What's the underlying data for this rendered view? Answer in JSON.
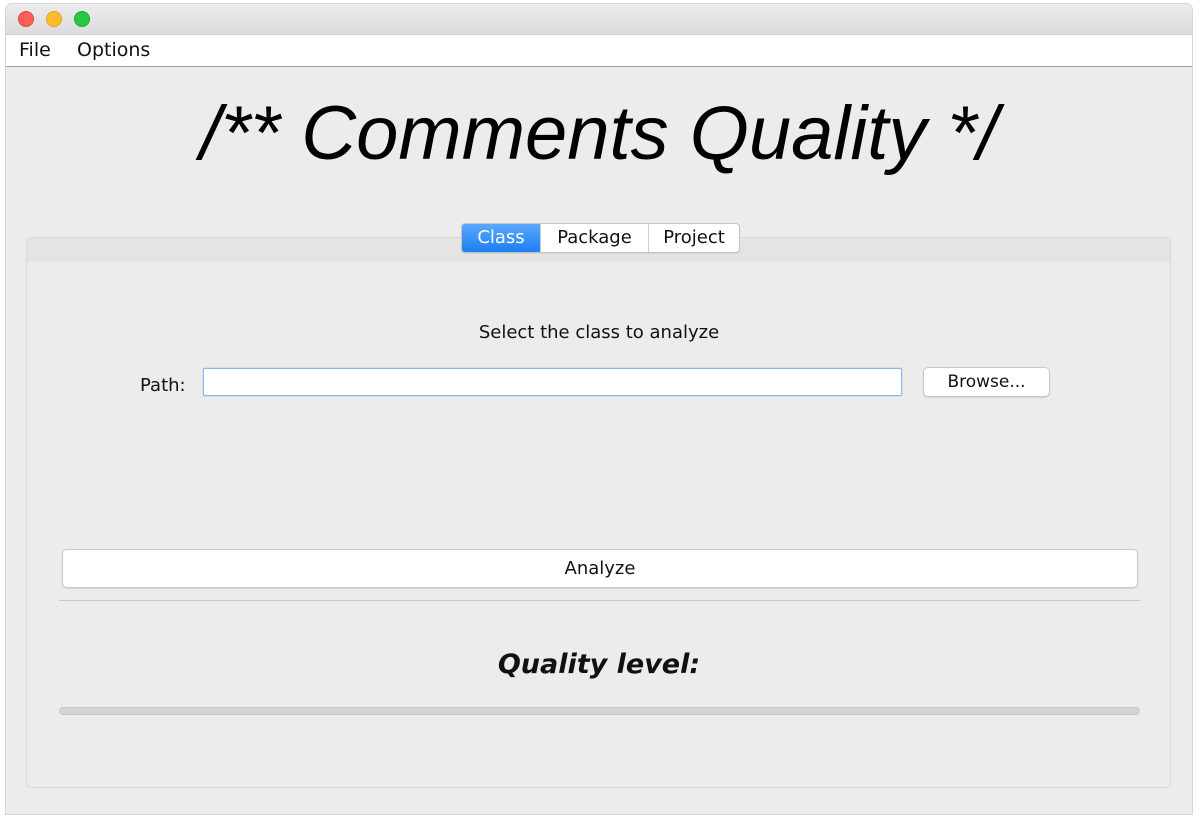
{
  "menu": {
    "file_label": "File",
    "options_label": "Options"
  },
  "app": {
    "title": "/** Comments Quality */"
  },
  "tabs": [
    {
      "label": "Class",
      "selected": true
    },
    {
      "label": "Package",
      "selected": false
    },
    {
      "label": "Project",
      "selected": false
    }
  ],
  "class_panel": {
    "instruction": "Select the class to analyze",
    "path_label": "Path:",
    "path_value": "",
    "browse_label": "Browse...",
    "analyze_label": "Analyze"
  },
  "quality": {
    "label": "Quality level:",
    "progress": 0
  },
  "colors": {
    "accent": "#1c7ff5",
    "window_bg": "#ececec",
    "close": "#fc5f57",
    "minimize": "#fdbc2e",
    "maximize": "#28c840"
  }
}
